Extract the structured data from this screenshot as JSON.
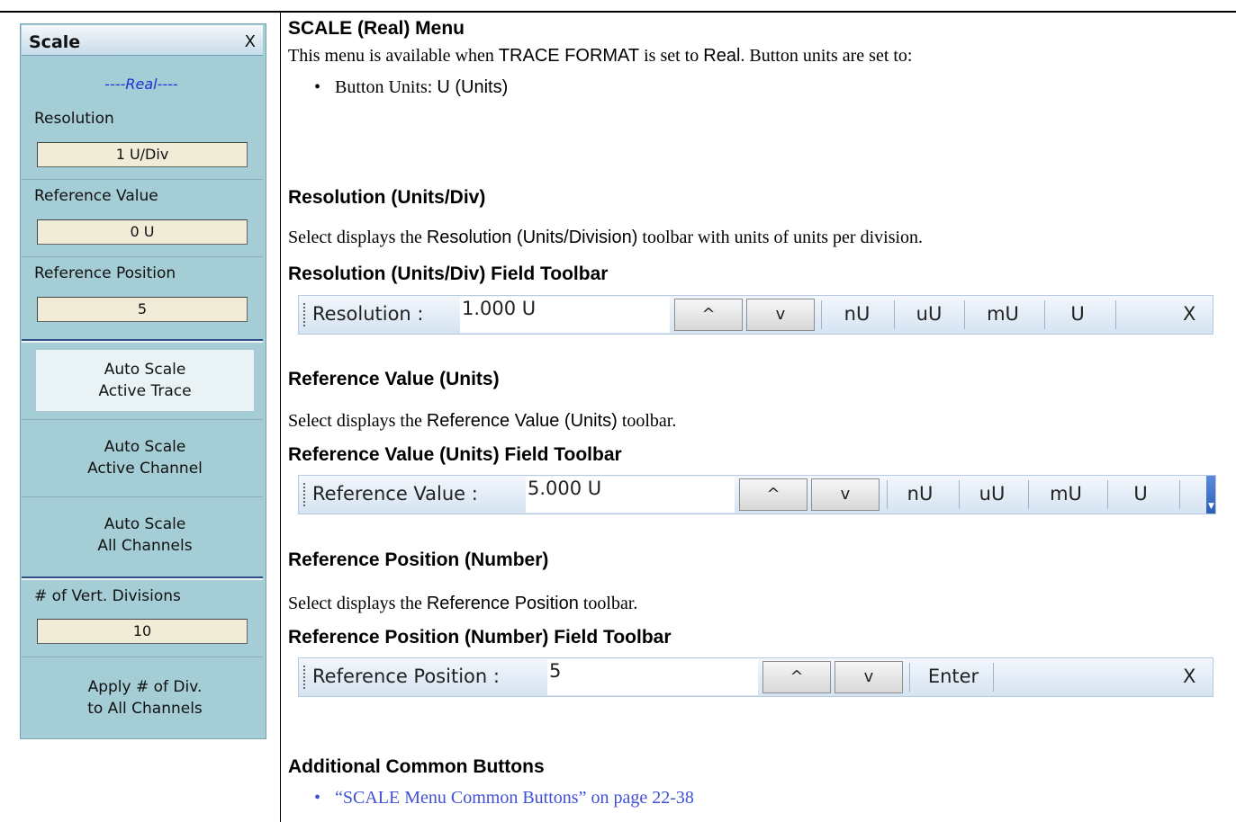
{
  "menu": {
    "title": "Scale",
    "close": "X",
    "subtitle": "----Real----",
    "resolution_label": "Resolution",
    "resolution_value": "1 U/Div",
    "ref_value_label": "Reference Value",
    "ref_value_value": "0 U",
    "ref_position_label": "Reference Position",
    "ref_position_value": "5",
    "auto_trace_1": "Auto Scale",
    "auto_trace_2": "Active Trace",
    "auto_channel_1": "Auto Scale",
    "auto_channel_2": "Active Channel",
    "auto_all_1": "Auto Scale",
    "auto_all_2": "All Channels",
    "divisions_label": "# of Vert. Divisions",
    "divisions_value": "10",
    "apply_1": "Apply # of Div.",
    "apply_2": "to All Channels"
  },
  "doc": {
    "heading_main": "SCALE (Real) Menu",
    "intro_a": "This menu is available when ",
    "intro_b": "TRACE FORMAT",
    "intro_c": " is set to ",
    "intro_d": "Real",
    "intro_e": ". Button units are set to:",
    "bullet_units_a": "Button Units: ",
    "bullet_units_b": "U (Units)",
    "heading_resolution": "Resolution (Units/Div)",
    "resolution_desc_a": "Select displays the ",
    "resolution_desc_b": "Resolution (Units/Division)",
    "resolution_desc_c": " toolbar with units of units per division.",
    "heading_resolution_tb": "Resolution (Units/Div) Field Toolbar",
    "heading_refvalue": "Reference Value (Units)",
    "refvalue_desc_a": "Select displays the ",
    "refvalue_desc_b": "Reference Value (Units)",
    "refvalue_desc_c": " toolbar.",
    "heading_refvalue_tb": "Reference Value (Units) Field Toolbar",
    "heading_refpos": "Reference Position (Number)",
    "refpos_desc_a": "Select displays the ",
    "refpos_desc_b": "Reference Position",
    "refpos_desc_c": " toolbar.",
    "heading_refpos_tb": "Reference Position (Number) Field Toolbar",
    "heading_common": "Additional Common Buttons",
    "common_link": "“SCALE Menu Common Buttons” on page 22-38"
  },
  "toolbars": {
    "resolution": {
      "label": "Resolution  :",
      "value": "1.000  U",
      "up": "^",
      "down": "v",
      "units": [
        "nU",
        "uU",
        "mU",
        "U"
      ],
      "close": "X"
    },
    "refvalue": {
      "label": "Reference Value  :",
      "value": "5.000  U",
      "up": "^",
      "down": "v",
      "units": [
        "nU",
        "uU",
        "mU",
        "U"
      ]
    },
    "refpos": {
      "label": "Reference Position  :",
      "value": "5",
      "up": "^",
      "down": "v",
      "enter": "Enter",
      "close": "X"
    }
  },
  "colors": {
    "menu_bg": "#a5cdd5",
    "field_bg": "#f0ecd8",
    "subtitle": "#1a33d6",
    "link": "#3f51d6",
    "toolbar_bg": "#dbe7f4"
  }
}
